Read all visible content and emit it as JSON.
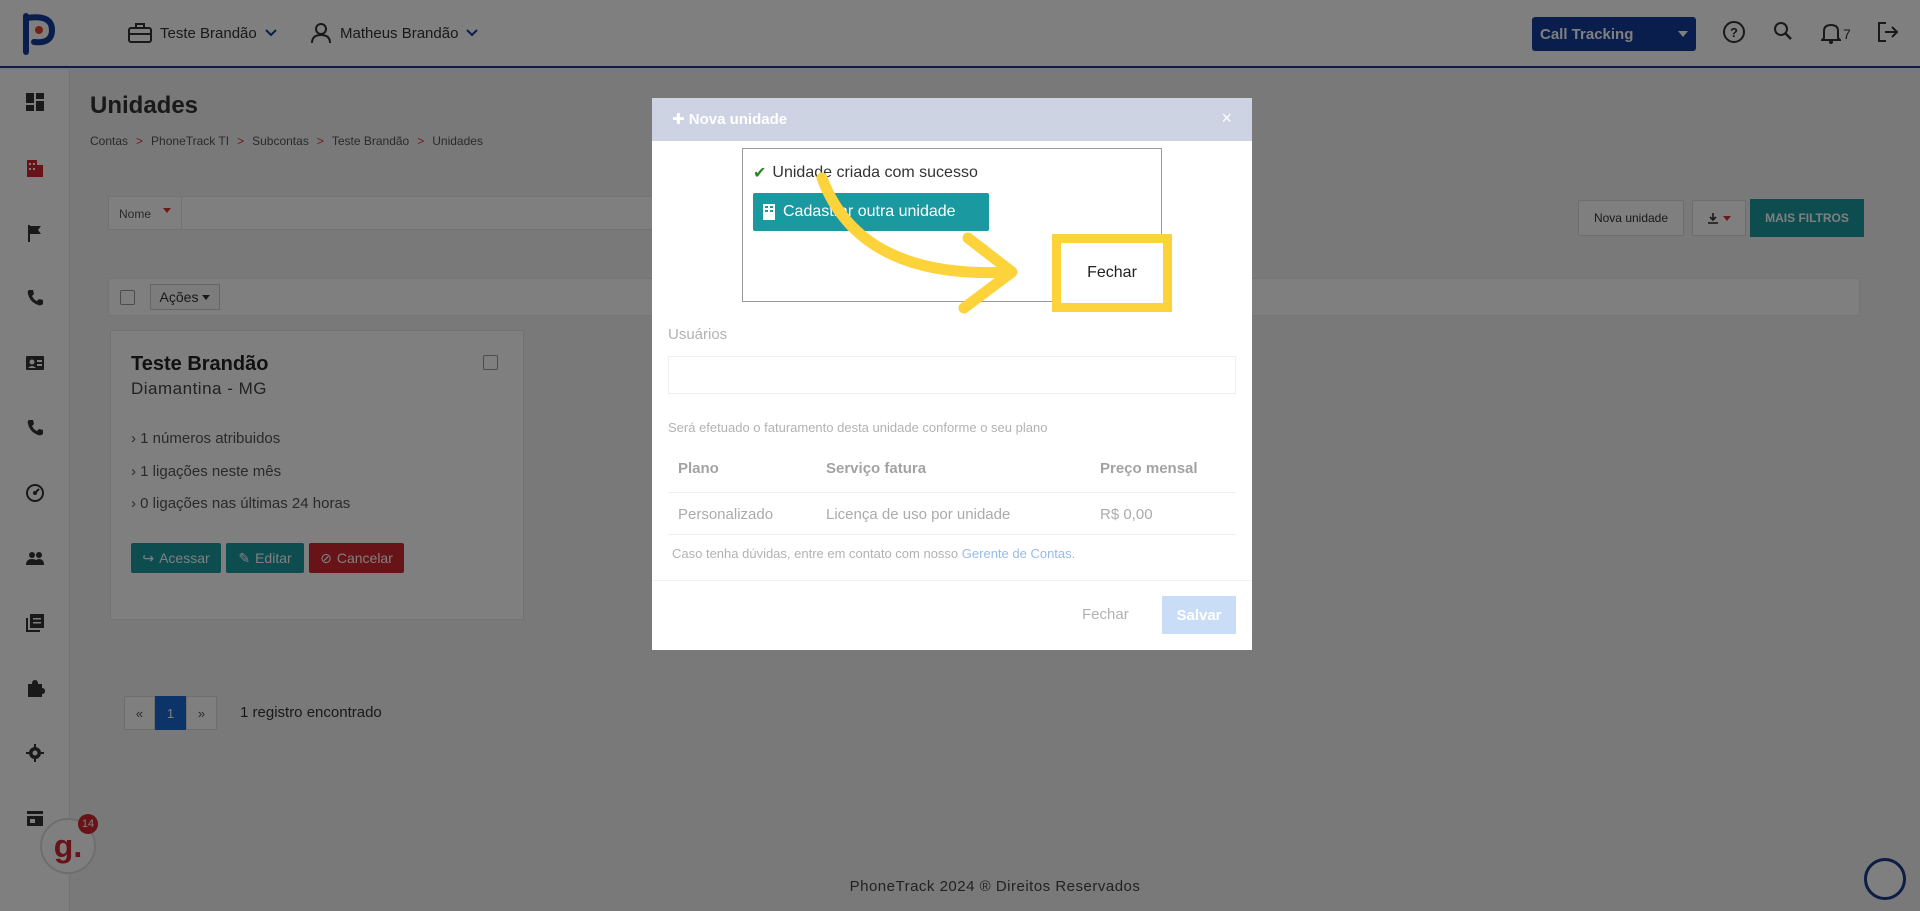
{
  "topbar": {
    "account": "Teste Brandão",
    "user": "Matheus Brandão",
    "product_select": "Call Tracking",
    "notifications_count": "7"
  },
  "page": {
    "title": "Unidades",
    "breadcrumb": [
      "Contas",
      "PhoneTrack TI",
      "Subcontas",
      "Teste Brandão",
      "Unidades"
    ],
    "breadcrumb_sep": ">"
  },
  "toolbar": {
    "filter_label": "Nome",
    "nova_unidade": "Nova unidade",
    "mais_filtros": "MAIS FILTROS",
    "acoes": "Ações"
  },
  "card": {
    "title": "Teste Brandão",
    "subtitle": "Diamantina - MG",
    "lines": [
      "1 números atribuidos",
      "1 ligações neste mês",
      "0 ligações nas últimas 24 horas"
    ],
    "btn_acessar": "Acessar",
    "btn_editar": "Editar",
    "btn_cancelar": "Cancelar"
  },
  "pagination": {
    "prev": "«",
    "current": "1",
    "next": "»",
    "info": "1 registro encontrado"
  },
  "footer": {
    "text": "PhoneTrack 2024 ® Direitos Reservados"
  },
  "widget": {
    "badge_count": "14",
    "badge_letter": "g."
  },
  "modal": {
    "title": "Nova unidade",
    "close": "×",
    "success_message": "Unidade criada com sucesso",
    "cadastrar_outra": "Cadastrar outra unidade",
    "fechar_highlight": "Fechar",
    "usuarios_label": "Usuários",
    "billing_note": "Será efetuado o faturamento desta unidade conforme o seu plano",
    "table_headers": [
      "Plano",
      "Serviço fatura",
      "Preço mensal"
    ],
    "table_row": [
      "Personalizado",
      "Licença de uso por unidade",
      "R$ 0,00"
    ],
    "help_text": "Caso tenha dúvidas, entre em contato com nosso",
    "help_link": "Gerente de Contas.",
    "fechar": "Fechar",
    "salvar": "Salvar"
  },
  "colors": {
    "brand_blue": "#123d9a",
    "teal": "#1a9aa0",
    "danger": "#d0262e",
    "highlight": "#fcd33b"
  }
}
